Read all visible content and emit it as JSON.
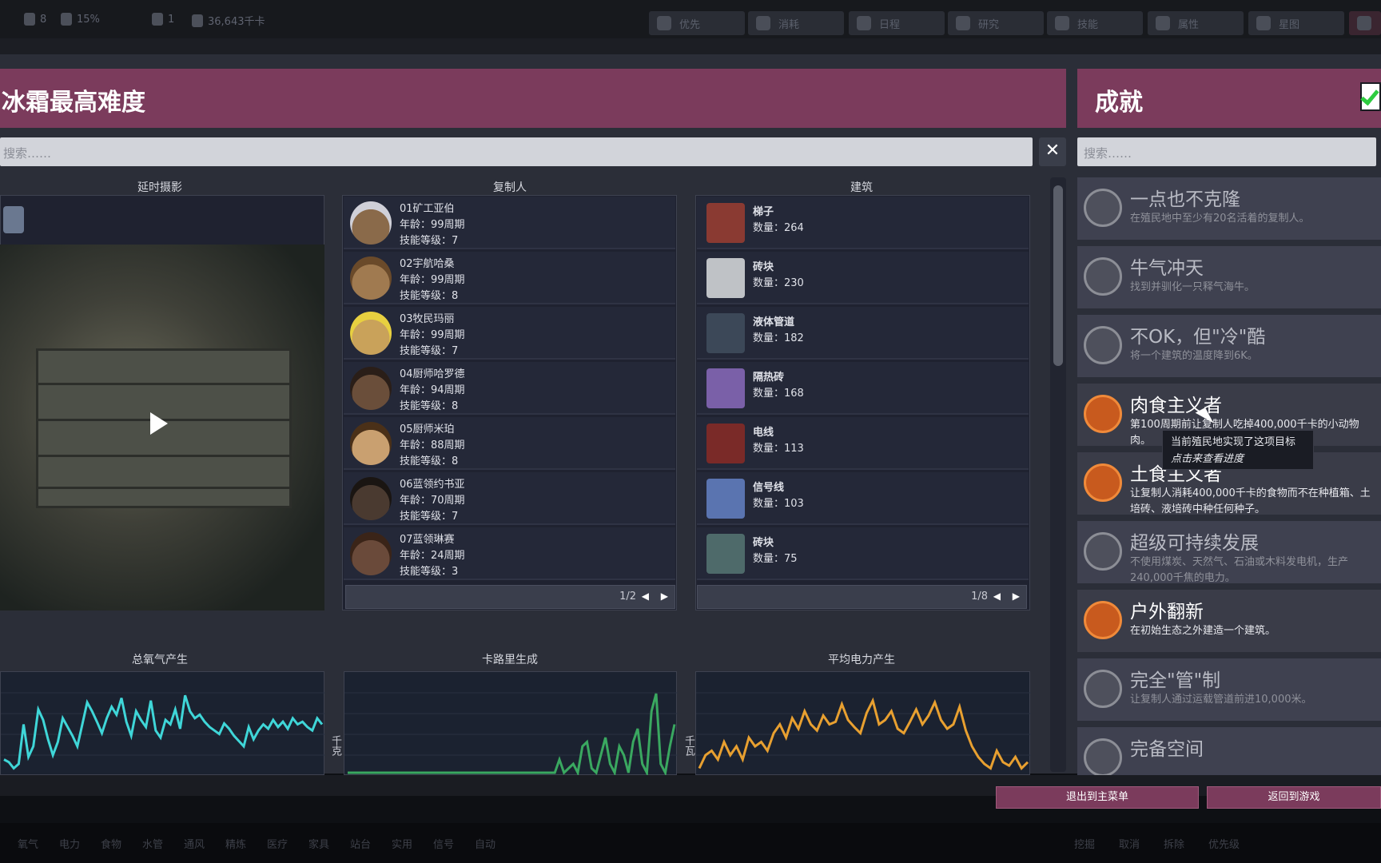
{
  "topbar": {
    "stats": [
      {
        "icon": "duplicant-icon",
        "value": "8"
      },
      {
        "icon": "stress-icon",
        "value": "15%"
      },
      {
        "icon": "sick-icon",
        "value": "1"
      },
      {
        "icon": "food-icon",
        "value": "36,643千卡"
      }
    ],
    "buttons": [
      {
        "icon": "priority-icon",
        "label": "优先"
      },
      {
        "icon": "consumables-icon",
        "label": "消耗"
      },
      {
        "icon": "schedule-icon",
        "label": "日程"
      },
      {
        "icon": "research-icon",
        "label": "研究"
      },
      {
        "icon": "skills-icon",
        "label": "技能"
      },
      {
        "icon": "vitals-icon",
        "label": "属性"
      },
      {
        "icon": "starmap-icon",
        "label": "星图"
      },
      {
        "icon": "report-icon",
        "label": ""
      }
    ]
  },
  "left": {
    "title": "冰霜最高难度",
    "search_placeholder": "搜索……",
    "clear_label": "✕",
    "columns": {
      "timelapse": "延时摄影",
      "duplicants": "复制人",
      "buildings": "建筑"
    },
    "duplicants": [
      {
        "name": "01矿工亚伯",
        "age": "年龄：99周期",
        "skill": "技能等级：7"
      },
      {
        "name": "02宇航哈桑",
        "age": "年龄：99周期",
        "skill": "技能等级：8"
      },
      {
        "name": "03牧民玛丽",
        "age": "年龄：99周期",
        "skill": "技能等级：7"
      },
      {
        "name": "04厨师哈罗德",
        "age": "年龄：94周期",
        "skill": "技能等级：8"
      },
      {
        "name": "05厨师米珀",
        "age": "年龄：88周期",
        "skill": "技能等级：8"
      },
      {
        "name": "06蓝领约书亚",
        "age": "年龄：70周期",
        "skill": "技能等级：7"
      },
      {
        "name": "07蓝领琳赛",
        "age": "年龄：24周期",
        "skill": "技能等级：3"
      }
    ],
    "duplicant_page": "1/2",
    "buildings": [
      {
        "name": "梯子",
        "count": "数量：264",
        "color": "#8a3a32"
      },
      {
        "name": "砖块",
        "count": "数量：230",
        "color": "#bfc2c6"
      },
      {
        "name": "液体管道",
        "count": "数量：182",
        "color": "#3c4858"
      },
      {
        "name": "隔热砖",
        "count": "数量：168",
        "color": "#7a60a8"
      },
      {
        "name": "电线",
        "count": "数量：113",
        "color": "#7a2a28"
      },
      {
        "name": "信号线",
        "count": "数量：103",
        "color": "#5a74b0"
      },
      {
        "name": "砖块",
        "count": "数量：75",
        "color": "#4e6a6a"
      }
    ],
    "building_page": "1/8",
    "chart_titles": {
      "oxygen": "总氧气产生",
      "calories": "卡路里生成",
      "power": "平均电力产生"
    },
    "chart_units": {
      "oxygen": "千克",
      "power": "千瓦"
    }
  },
  "right": {
    "title": "成就",
    "search_placeholder": "搜索……",
    "achievements": [
      {
        "title": "一点也不克隆",
        "desc": "在殖民地中至少有20名活着的复制人。",
        "done": false,
        "icon": "clone-icon"
      },
      {
        "title": "牛气冲天",
        "desc": "找到并驯化一只释气海牛。",
        "done": false,
        "icon": "critter-icon"
      },
      {
        "title": "不OK，但\"冷\"酷",
        "desc": "将一个建筑的温度降到6K。",
        "done": false,
        "icon": "snowflake-icon"
      },
      {
        "title": "肉食主义者",
        "desc": "第100周期前让复制人吃掉400,000千卡的小动物肉。",
        "done": true,
        "icon": "meat-icon"
      },
      {
        "title": "土食主义者",
        "desc": "让复制人消耗400,000千卡的食物而不在种植箱、土培砖、液培砖中种任何种子。",
        "done": true,
        "icon": "plant-icon"
      },
      {
        "title": "超级可持续发展",
        "desc": "不使用煤炭、天然气、石油或木料发电机，生产240,000千焦的电力。",
        "done": false,
        "icon": "sustainability-icon"
      },
      {
        "title": "户外翻新",
        "desc": "在初始生态之外建造一个建筑。",
        "done": true,
        "icon": "house-icon"
      },
      {
        "title": "完全\"管\"制",
        "desc": "让复制人通过运载管道前进10,000米。",
        "done": false,
        "icon": "tube-icon"
      },
      {
        "title": "完备空间",
        "desc": "",
        "done": false,
        "icon": "room-icon"
      }
    ],
    "tooltip_line1": "当前殖民地实现了这项目标",
    "tooltip_line2": "点击来查看进度"
  },
  "footer": {
    "exit_label": "退出到主菜单",
    "resume_label": "返回到游戏"
  },
  "bottombar": {
    "items": [
      "氧气",
      "电力",
      "食物",
      "水管",
      "通风",
      "精炼",
      "医疗",
      "家具",
      "站台",
      "实用",
      "信号",
      "自动"
    ],
    "right_items": [
      "挖掘",
      "取消",
      "拆除",
      "优先级"
    ]
  },
  "chart_data": [
    {
      "type": "line",
      "title": "总氧气产生",
      "ylabel": "千克",
      "series": [
        {
          "values": [
            0.15,
            0.12,
            0.05,
            0.1,
            0.55,
            0.18,
            0.3,
            0.72,
            0.6,
            0.38,
            0.2,
            0.35,
            0.62,
            0.52,
            0.42,
            0.3,
            0.55,
            0.8,
            0.7,
            0.58,
            0.45,
            0.62,
            0.75,
            0.66,
            0.85,
            0.58,
            0.42,
            0.7,
            0.6,
            0.52,
            0.82,
            0.48,
            0.4,
            0.6,
            0.55,
            0.72,
            0.5,
            0.88,
            0.7,
            0.62,
            0.66,
            0.58,
            0.52,
            0.48,
            0.44,
            0.56,
            0.5,
            0.42,
            0.36,
            0.3,
            0.52,
            0.38,
            0.48,
            0.55,
            0.5,
            0.6,
            0.52,
            0.58,
            0.5,
            0.62,
            0.55,
            0.58,
            0.52,
            0.48,
            0.62,
            0.55
          ]
        }
      ],
      "color": "#3fd6d8"
    },
    {
      "type": "line",
      "title": "卡路里生成",
      "series": [
        {
          "values": [
            0,
            0,
            0,
            0,
            0,
            0,
            0,
            0,
            0,
            0,
            0,
            0,
            0,
            0,
            0,
            0,
            0,
            0,
            0,
            0,
            0,
            0,
            0,
            0,
            0,
            0,
            0,
            0,
            0,
            0,
            0,
            0,
            0,
            0,
            0,
            0,
            0,
            0,
            0,
            0,
            0,
            0,
            0,
            0,
            0,
            0,
            0.15,
            0,
            0.05,
            0.1,
            0,
            0.3,
            0.35,
            0.05,
            0,
            0.2,
            0.4,
            0.1,
            0,
            0.3,
            0.2,
            0,
            0.35,
            0.5,
            0.1,
            0,
            0.7,
            0.9,
            0.1,
            0,
            0.3,
            0.55
          ]
        }
      ],
      "color": "#3aa860"
    },
    {
      "type": "line",
      "title": "平均电力产生",
      "ylabel": "千瓦",
      "series": [
        {
          "values": [
            0.05,
            0.2,
            0.25,
            0.15,
            0.35,
            0.2,
            0.3,
            0.15,
            0.4,
            0.3,
            0.35,
            0.25,
            0.45,
            0.55,
            0.4,
            0.62,
            0.5,
            0.7,
            0.55,
            0.48,
            0.65,
            0.55,
            0.58,
            0.78,
            0.6,
            0.52,
            0.45,
            0.68,
            0.82,
            0.55,
            0.6,
            0.7,
            0.5,
            0.45,
            0.58,
            0.72,
            0.55,
            0.65,
            0.8,
            0.6,
            0.5,
            0.55,
            0.75,
            0.48,
            0.3,
            0.18,
            0.1,
            0.05,
            0.25,
            0.12,
            0.08,
            0.18,
            0.05,
            0.12
          ]
        }
      ],
      "color": "#e8a030"
    }
  ]
}
